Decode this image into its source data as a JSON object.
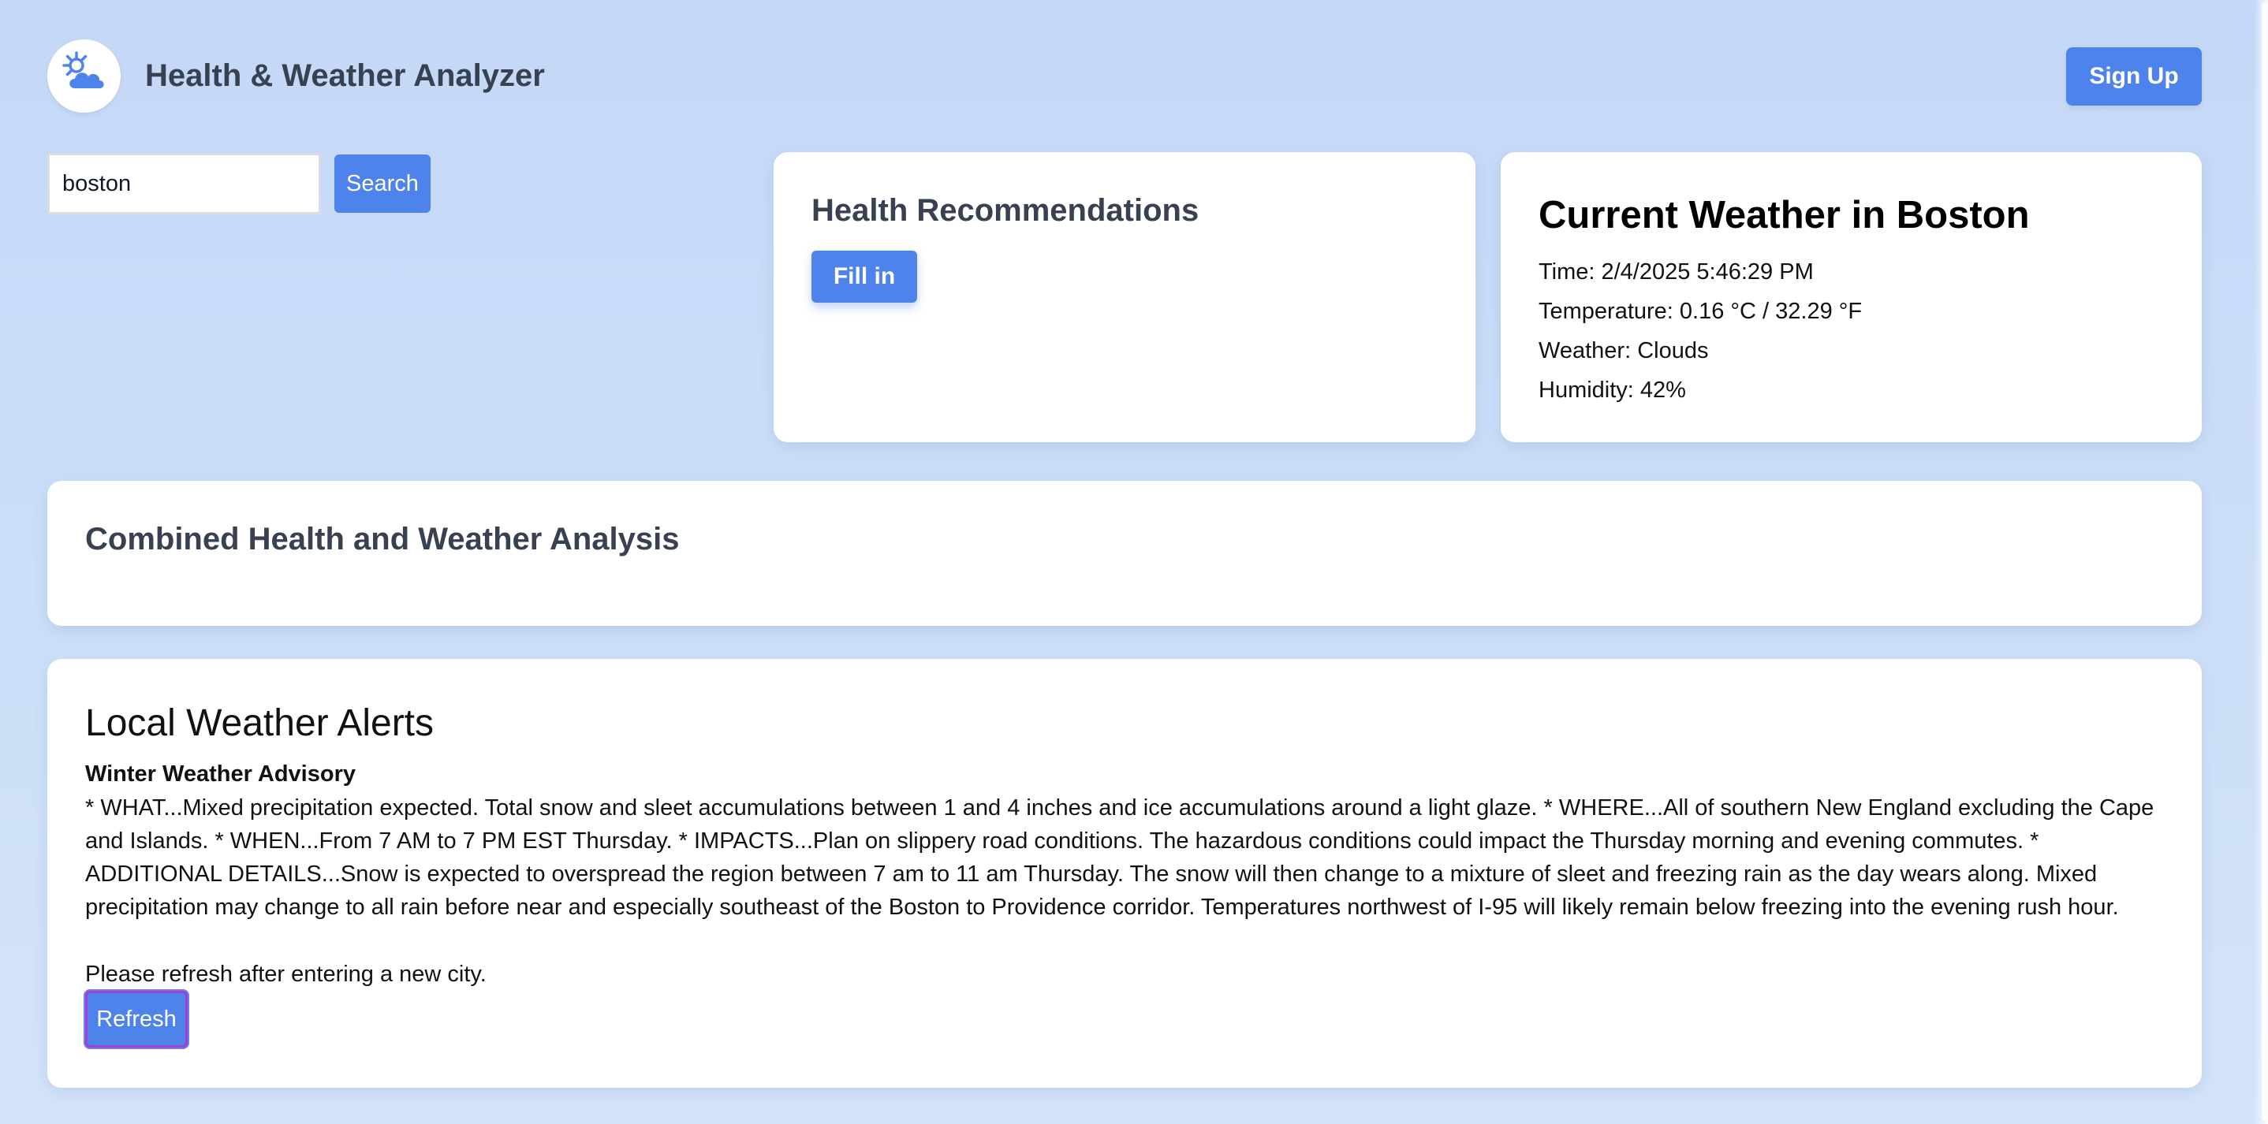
{
  "header": {
    "title": "Health & Weather Analyzer",
    "logo_icon": "sun-cloud-icon",
    "signup_label": "Sign Up"
  },
  "search": {
    "value": "boston",
    "button_label": "Search"
  },
  "health": {
    "title": "Health Recommendations",
    "fill_in_label": "Fill in"
  },
  "weather": {
    "title": "Current Weather in Boston",
    "time": "Time: 2/4/2025 5:46:29 PM",
    "temperature": "Temperature: 0.16 °C / 32.29 °F",
    "condition": "Weather: Clouds",
    "humidity": "Humidity: 42%"
  },
  "combined": {
    "title": "Combined Health and Weather Analysis"
  },
  "alerts": {
    "title": "Local Weather Alerts",
    "items": [
      {
        "name": "Winter Weather Advisory",
        "description": "* WHAT...Mixed precipitation expected. Total snow and sleet accumulations between 1 and 4 inches and ice accumulations around a light glaze. * WHERE...All of southern New England excluding the Cape and Islands. * WHEN...From 7 AM to 7 PM EST Thursday. * IMPACTS...Plan on slippery road conditions. The hazardous conditions could impact the Thursday morning and evening commutes. * ADDITIONAL DETAILS...Snow is expected to overspread the region between 7 am to 11 am Thursday. The snow will then change to a mixture of sleet and freezing rain as the day wears along. Mixed precipitation may change to all rain before near and especially southeast of the Boston to Providence corridor. Temperatures northwest of I-95 will likely remain below freezing into the evening rush hour."
      }
    ],
    "refresh_note": "Please refresh after entering a new city.",
    "refresh_label": "Refresh"
  },
  "colors": {
    "accent": "#4f83ec",
    "background": "#c4d8f7",
    "card": "#ffffff"
  }
}
